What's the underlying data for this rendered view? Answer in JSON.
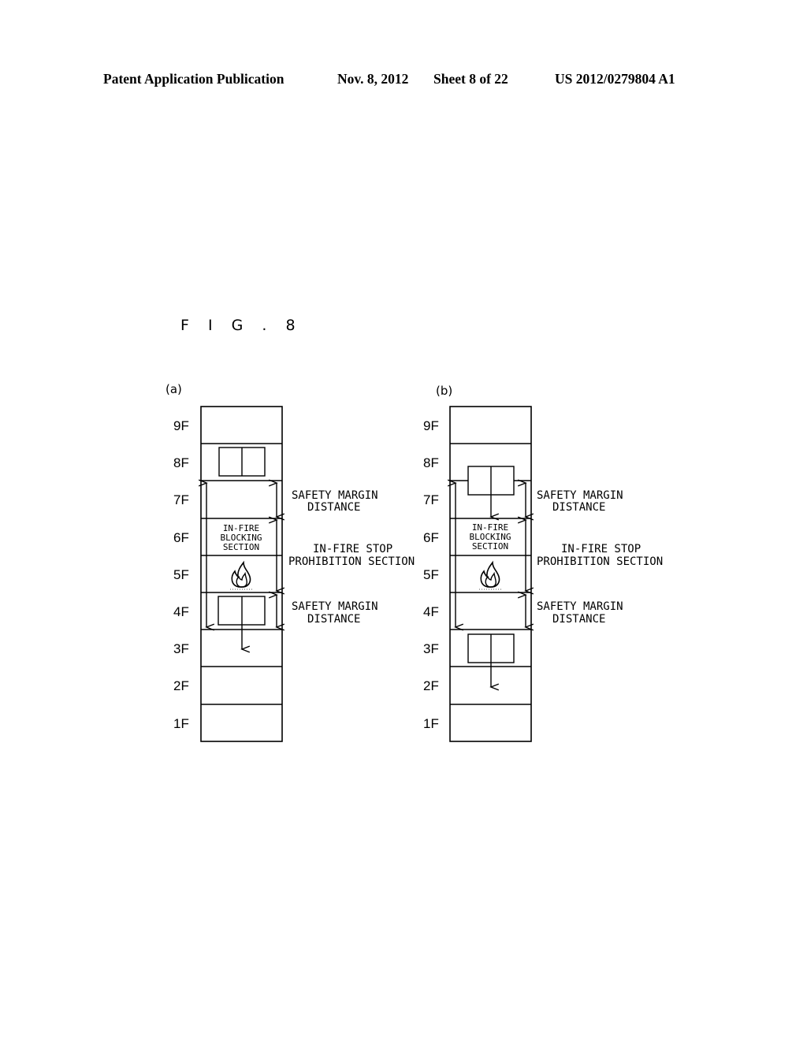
{
  "header": {
    "publication": "Patent Application Publication",
    "date": "Nov. 8, 2012",
    "sheet": "Sheet 8 of 22",
    "number": "US 2012/0279804 A1"
  },
  "figure": {
    "title": "F I G . 8"
  },
  "floors": [
    "9F",
    "8F",
    "7F",
    "6F",
    "5F",
    "4F",
    "3F",
    "2F",
    "1F"
  ],
  "panels": [
    {
      "id": "a",
      "label": "(a)",
      "car_floor": "8F",
      "car_floor_end": "4F",
      "car_stop_floor": "4F",
      "car_continue_to": "3F",
      "fire_floor": "5F",
      "blocking_floor": "6F",
      "labels": {
        "safety_margin_upper": [
          "SAFETY MARGIN",
          "DISTANCE"
        ],
        "stop_prohibition": [
          "IN-FIRE STOP",
          "PROHIBITION SECTION"
        ],
        "safety_margin_lower": [
          "SAFETY MARGIN",
          "DISTANCE"
        ],
        "blocking_section": [
          "IN-FIRE",
          "BLOCKING",
          "SECTION"
        ]
      }
    },
    {
      "id": "b",
      "label": "(b)",
      "car_floor_start": "8F/7F",
      "car_floor_end": "3F",
      "fire_floor": "5F",
      "blocking_floor": "6F",
      "labels": {
        "safety_margin_upper": [
          "SAFETY MARGIN",
          "DISTANCE"
        ],
        "stop_prohibition": [
          "IN-FIRE STOP",
          "PROHIBITION SECTION"
        ],
        "safety_margin_lower": [
          "SAFETY MARGIN",
          "DISTANCE"
        ],
        "blocking_section": [
          "IN-FIRE",
          "BLOCKING",
          "SECTION"
        ]
      }
    }
  ],
  "icons": {
    "fire": "fire-icon",
    "car": "elevator-car-icon",
    "arrow": "arrow-down-icon"
  }
}
